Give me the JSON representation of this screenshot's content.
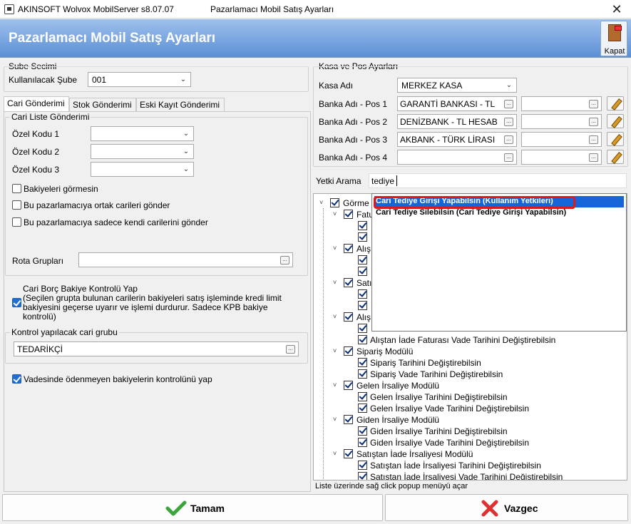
{
  "window": {
    "app_title": "AKINSOFT Wolvox MobilServer s8.07.07",
    "dialog_title": "Pazarlamacı Mobil Satış Ayarları",
    "close_glyph": "✕"
  },
  "header": {
    "title": "Pazarlamacı Mobil Satış Ayarları",
    "kapat_label": "Kapat"
  },
  "sube": {
    "group_label": "Sube Secimi",
    "field_label": "Kullanılacak Şube",
    "value": "001"
  },
  "tabs": [
    {
      "label": "Cari Gönderimi",
      "selected": true
    },
    {
      "label": "Stok Gönderimi",
      "selected": false
    },
    {
      "label": "Eski Kayıt Gönderimi",
      "selected": false
    }
  ],
  "cari": {
    "group_label": "Cari Liste Gönderimi",
    "ozel_kodu_1": "Özel Kodu 1",
    "ozel_kodu_2": "Özel Kodu 2",
    "ozel_kodu_3": "Özel Kodu 3",
    "cb_bakiyeler": "Bakiyeleri görmesin",
    "cb_ortak": "Bu pazarlamacıya ortak carileri gönder",
    "cb_kendi": "Bu pazarlamacıya sadece kendi carilerini gönder",
    "rota_label": "Rota Grupları",
    "borc_title": "Cari Borç Bakiye Kontrolü Yap",
    "borc_desc": "(Seçilen grupta bulunan carilerin bakiyeleri satış işleminde kredi limit bakiyesini geçerse uyarır ve işlemi durdurur. Sadece KPB bakiye kontrolü)",
    "kontrol_group_label": "Kontrol yapılacak cari grubu",
    "kontrol_value": "TEDARİKÇİ",
    "vadesinde_label": "Vadesinde ödenmeyen bakiyelerin kontrolünü yap"
  },
  "kasa": {
    "group_label": "Kasa ve Pos Ayarları",
    "kasa_label": "Kasa Adı",
    "kasa_value": "MERKEZ KASA",
    "pos": [
      {
        "label": "Banka Adı - Pos 1",
        "value": "GARANTİ BANKASI - TL"
      },
      {
        "label": "Banka Adı - Pos 2",
        "value": "DENİZBANK - TL HESAB"
      },
      {
        "label": "Banka Adı - Pos 3",
        "value": "AKBANK - TÜRK LİRASI"
      },
      {
        "label": "Banka Adı - Pos 4",
        "value": ""
      }
    ]
  },
  "yetki": {
    "label": "Yetki Arama",
    "search_value": "tediye",
    "suggestions": [
      "Cari Tediye Girişi Yapabilsin (Kullanım Yetkileri)",
      "Cari Tediye Silebilsin (Cari Tediye Girişi Yapabilsin)"
    ]
  },
  "tree": {
    "root": "Görme",
    "partial": [
      "Fatu",
      "Alış",
      "Satış",
      "Alış"
    ],
    "items": [
      {
        "level": 2,
        "label": "Alıştan İade Faturası Vade Tarihini Değiştirebilsin"
      },
      {
        "level": 1,
        "label": "Sipariş Modülü"
      },
      {
        "level": 2,
        "label": "Sipariş Tarihini Değiştirebilsin"
      },
      {
        "level": 2,
        "label": "Sipariş Vade Tarihini Değiştirebilsin"
      },
      {
        "level": 1,
        "label": "Gelen İrsaliye Modülü"
      },
      {
        "level": 2,
        "label": "Gelen İrsaliye Tarihini Değiştirebilsin"
      },
      {
        "level": 2,
        "label": "Gelen İrsaliye Vade Tarihini Değiştirebilsin"
      },
      {
        "level": 1,
        "label": "Giden İrsaliye Modülü"
      },
      {
        "level": 2,
        "label": "Giden İrsaliye Tarihini Değiştirebilsin"
      },
      {
        "level": 2,
        "label": "Giden İrsaliye Vade Tarihini Değiştirebilsin"
      },
      {
        "level": 1,
        "label": "Satıştan İade İrsaliyesi Modülü"
      },
      {
        "level": 2,
        "label": "Satıştan İade İrsaliyesi Tarihini Değiştirebilsin"
      },
      {
        "level": 2,
        "label": "Satıştan İade İrsaliyesi Vade Tarihini Değiştirebilsin"
      }
    ]
  },
  "status_text": "Liste üzerinde sağ click popup menüyü açar",
  "buttons": {
    "ok": "Tamam",
    "cancel": "Vazgec"
  },
  "colors": {
    "header_top": "#9fc1ec",
    "header_bottom": "#5b8fd6",
    "selection": "#1565d8",
    "highlight_border": "#e01818",
    "ok_check": "#3aa53a",
    "cancel_x": "#e03030"
  }
}
